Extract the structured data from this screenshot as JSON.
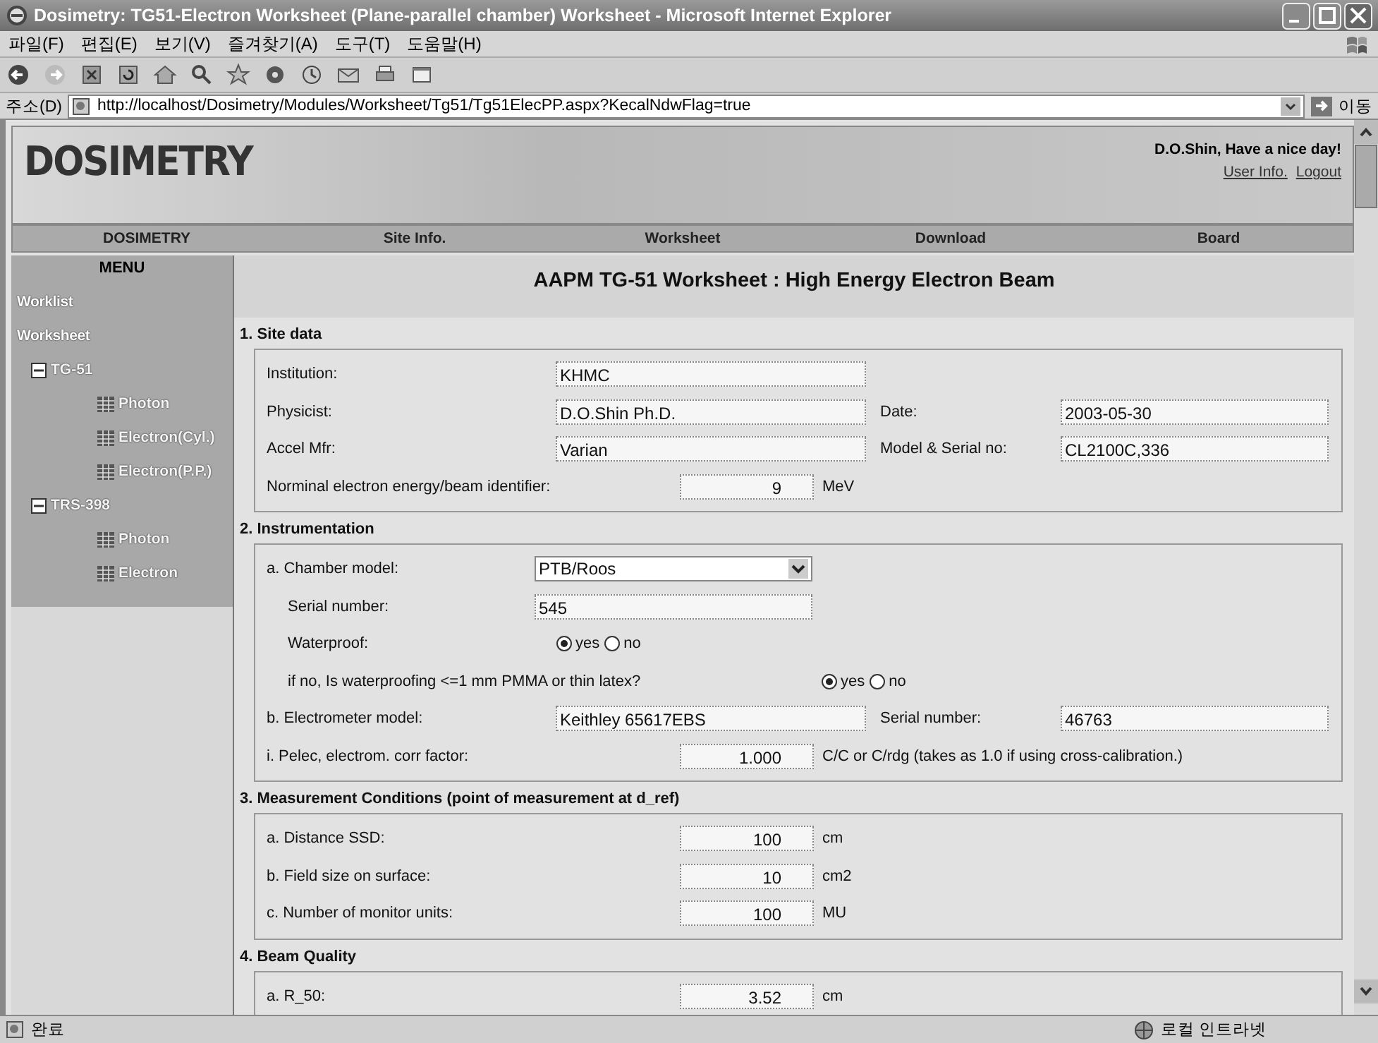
{
  "window": {
    "title": "Dosimetry: TG51-Electron Worksheet (Plane-parallel chamber) Worksheet - Microsoft Internet Explorer"
  },
  "menu_bar": [
    "파일(F)",
    "편집(E)",
    "보기(V)",
    "즐겨찾기(A)",
    "도구(T)",
    "도움말(H)"
  ],
  "address_bar": {
    "label": "주소(D)",
    "url": "http://localhost/Dosimetry/Modules/Worksheet/Tg51/Tg51ElecPP.aspx?KecalNdwFlag=true",
    "go": "이동"
  },
  "header": {
    "logo": "DOSIMETRY",
    "greeting": "D.O.Shin, Have a nice day!",
    "links": [
      "User Info.",
      "Logout"
    ]
  },
  "nav": [
    "DOSIMETRY",
    "Site Info.",
    "Worksheet",
    "Download",
    "Board"
  ],
  "sidebar": {
    "title": "MENU",
    "items": [
      {
        "label": "Worklist",
        "kind": "link"
      },
      {
        "label": "Worksheet",
        "kind": "link",
        "children": [
          {
            "label": "TG-51",
            "kind": "folder",
            "expanded": true,
            "children": [
              {
                "label": "Photon",
                "kind": "page"
              },
              {
                "label": "Electron(Cyl.)",
                "kind": "page"
              },
              {
                "label": "Electron(P.P.)",
                "kind": "page"
              }
            ]
          },
          {
            "label": "TRS-398",
            "kind": "folder",
            "expanded": true,
            "children": [
              {
                "label": "Photon",
                "kind": "page"
              },
              {
                "label": "Electron",
                "kind": "page"
              }
            ]
          }
        ]
      }
    ]
  },
  "worksheet": {
    "title": "AAPM TG-51 Worksheet : High Energy Electron Beam",
    "sections": [
      {
        "heading": "1. Site data",
        "rows": [
          {
            "kind": "text",
            "label": "Institution:",
            "value": "KHMC"
          },
          {
            "kind": "pair",
            "label": "Physicist:",
            "value": "D.O.Shin Ph.D.",
            "label2": "Date:",
            "value2": "2003-05-30"
          },
          {
            "kind": "pair",
            "label": "Accel Mfr:",
            "value": "Varian",
            "label2": "Model & Serial no:",
            "value2": "CL2100C,336"
          },
          {
            "kind": "number",
            "label": "Norminal electron energy/beam identifier:",
            "value": "9",
            "unit": "MeV"
          }
        ]
      },
      {
        "heading": "2. Instrumentation",
        "rows": [
          {
            "kind": "select",
            "label": "a. Chamber model:",
            "value": "PTB/Roos"
          },
          {
            "kind": "subtext",
            "label": "Serial number:",
            "value": "545"
          },
          {
            "kind": "radio",
            "label": "Waterproof:",
            "options": [
              {
                "label": "yes",
                "selected": true
              },
              {
                "label": "no",
                "selected": false
              }
            ]
          },
          {
            "kind": "radio_wide",
            "label": "if no, Is waterproofing <=1 mm PMMA or thin latex?",
            "options": [
              {
                "label": "yes",
                "selected": true
              },
              {
                "label": "no",
                "selected": false
              }
            ]
          },
          {
            "kind": "pair",
            "label": "b. Electrometer model:",
            "value": "Keithley 65617EBS",
            "label2": "Serial number:",
            "value2": "46763"
          },
          {
            "kind": "number",
            "label": "i. Pelec, electrom. corr factor:",
            "value": "1.000",
            "unit": "C/C or C/rdg (takes as 1.0 if using cross-calibration.)"
          }
        ]
      },
      {
        "heading": "3. Measurement Conditions (point of measurement at d_ref)",
        "rows": [
          {
            "kind": "number",
            "label": "a. Distance SSD:",
            "value": "100",
            "unit": "cm"
          },
          {
            "kind": "number",
            "label": "b. Field size on surface:",
            "value": "10",
            "unit": "cm2"
          },
          {
            "kind": "number",
            "label": "c. Number of monitor units:",
            "value": "100",
            "unit": "MU"
          }
        ]
      },
      {
        "heading": "4. Beam Quality",
        "rows": [
          {
            "kind": "number",
            "label": "a. R_50:",
            "value": "3.52",
            "unit": "cm"
          }
        ]
      }
    ]
  },
  "status_bar": {
    "text": "완료",
    "zone": "로컬 인트라넷"
  }
}
